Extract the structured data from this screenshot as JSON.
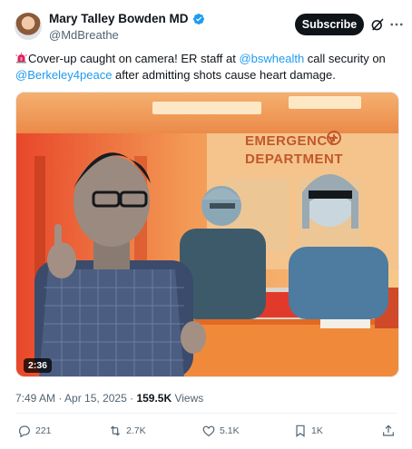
{
  "author": {
    "name": "Mary Talley Bowden MD",
    "handle": "@MdBreathe",
    "verified": true
  },
  "header": {
    "subscribe_label": "Subscribe",
    "grok_icon": "grok-icon",
    "more_icon": "more-icon"
  },
  "tweet": {
    "emoji_icon": "siren-icon",
    "text_part1": "Cover-up caught on camera! ER staff at ",
    "mention1": "@bswhealth",
    "text_part2": " call security on ",
    "mention2": "@Berkeley4peace",
    "text_part3": " after admitting shots cause heart damage."
  },
  "media": {
    "sign_line1": "EMERGENCY",
    "sign_line2": "DEPARTMENT",
    "duration": "2:36"
  },
  "meta": {
    "time": "7:49 AM",
    "separator": " · ",
    "date": "Apr 15, 2025",
    "views_count": "159.5K",
    "views_label": " Views"
  },
  "actions": {
    "replies": "221",
    "reposts": "2.7K",
    "likes": "5.1K",
    "bookmarks": "1K"
  },
  "colors": {
    "accent": "#1d9bf0",
    "text": "#0f1419",
    "muted": "#536471",
    "subscribe_bg": "#0f1419"
  }
}
